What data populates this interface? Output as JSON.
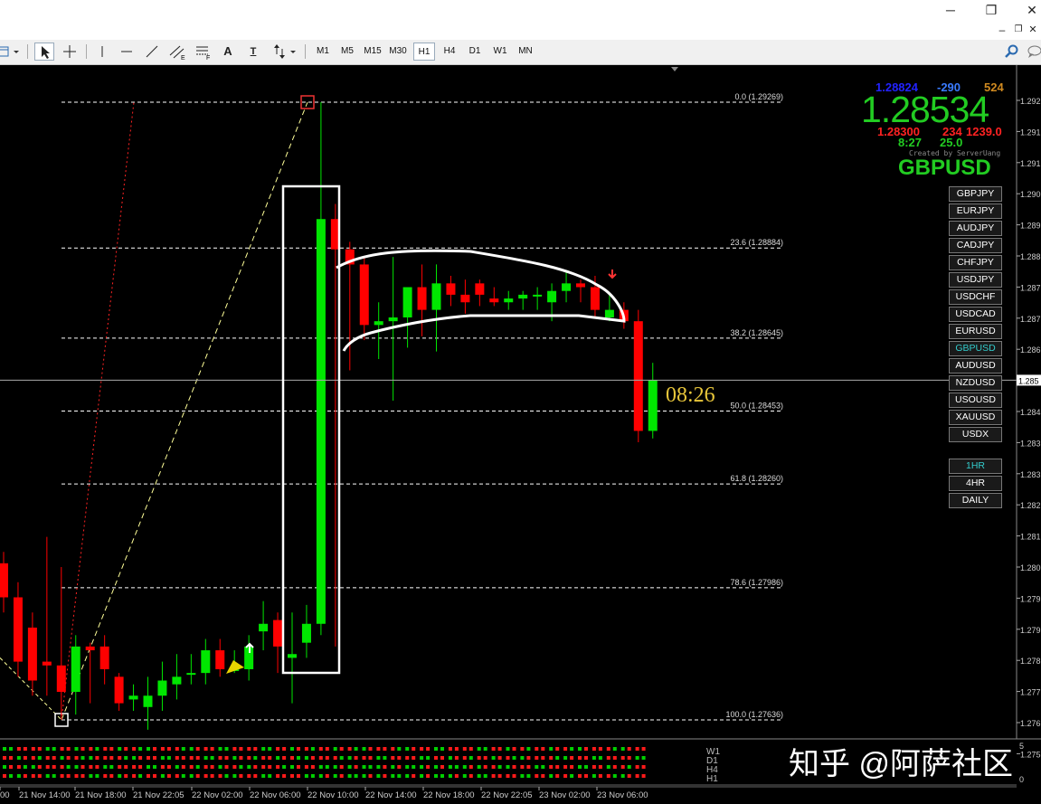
{
  "window": {
    "minimize": "─",
    "restore": "❐",
    "close": "✕",
    "inner_minimize": "–",
    "inner_restore": "❐",
    "inner_close": "✕"
  },
  "toolbar": {
    "timeframes": [
      "M1",
      "M5",
      "M15",
      "M30",
      "H1",
      "H4",
      "D1",
      "W1",
      "MN"
    ],
    "active_timeframe": "H1",
    "text_tool": "A",
    "text_label_tool": "T"
  },
  "price_axis": {
    "labels": [
      "1.292",
      "1.291",
      "1.291",
      "1.290",
      "1.289",
      "1.288",
      "1.287",
      "1.287",
      "1.286",
      "1.285",
      "1.284",
      "1.283",
      "1.283",
      "1.282",
      "1.281",
      "1.280",
      "1.279",
      "1.279",
      "1.278",
      "1.277",
      "1.276",
      "1.275"
    ],
    "current": "1.285"
  },
  "time_axis": {
    "labels": [
      "00",
      "21 Nov 14:00",
      "21 Nov 18:00",
      "21 Nov 22:05",
      "22 Nov 02:00",
      "22 Nov 06:00",
      "22 Nov 10:00",
      "22 Nov 14:00",
      "22 Nov 18:00",
      "22 Nov 22:05",
      "23 Nov 02:00",
      "23 Nov 06:00"
    ]
  },
  "fibonacci": [
    {
      "label": "0.0 (1.29269)"
    },
    {
      "label": "23.6 (1.28884)"
    },
    {
      "label": "38.2 (1.28645)"
    },
    {
      "label": "50.0 (1.28453)"
    },
    {
      "label": "61.8 (1.28260)"
    },
    {
      "label": "78.6 (1.27986)"
    },
    {
      "label": "100.0 (1.27636)"
    }
  ],
  "info_panel": {
    "bid": "1.28824",
    "spread": "-290",
    "range": "524",
    "price": "1.28534",
    "low": "1.28300",
    "pips": "234",
    "value": "1239.0",
    "time": "8:27",
    "num": "25.0",
    "credit": "Created by ServerUang",
    "symbol": "GBPUSD"
  },
  "countdown": "08:26",
  "symbol_buttons": [
    "GBPJPY",
    "EURJPY",
    "AUDJPY",
    "CADJPY",
    "CHFJPY",
    "USDJPY",
    "USDCHF",
    "USDCAD",
    "EURUSD",
    "GBPUSD",
    "AUDUSD",
    "NZDUSD",
    "USOUSD",
    "XAUUSD",
    "USDX"
  ],
  "active_symbol": "GBPUSD",
  "timeframe_buttons": [
    "1HR",
    "4HR",
    "DAILY"
  ],
  "active_tf_button": "1HR",
  "subwindow": {
    "rows": [
      "W1",
      "D1",
      "H4",
      "H1"
    ],
    "scale_top": "5",
    "scale_bottom": "0"
  },
  "watermark": "知乎 @阿萨社区",
  "colors": {
    "bull": "#00e600",
    "bear": "#ff0000",
    "fib": "#ffffff",
    "zigzag": "#ffff99",
    "zigzag_red": "#ff2222",
    "countdown": "#e8c63a",
    "price_big": "#22cc22"
  },
  "chart_data": {
    "type": "candlestick",
    "candles": [
      {
        "o": 1.2805,
        "h": 1.2808,
        "l": 1.2792,
        "c": 1.2796
      },
      {
        "o": 1.2796,
        "h": 1.28,
        "l": 1.2775,
        "c": 1.2779
      },
      {
        "o": 1.2788,
        "h": 1.2792,
        "l": 1.277,
        "c": 1.2774
      },
      {
        "o": 1.2779,
        "h": 1.2812,
        "l": 1.277,
        "c": 1.2778
      },
      {
        "o": 1.2778,
        "h": 1.2804,
        "l": 1.2764,
        "c": 1.2771
      },
      {
        "o": 1.2771,
        "h": 1.2786,
        "l": 1.2765,
        "c": 1.2783
      },
      {
        "o": 1.2783,
        "h": 1.2784,
        "l": 1.2768,
        "c": 1.2782
      },
      {
        "o": 1.2783,
        "h": 1.2786,
        "l": 1.2773,
        "c": 1.2777
      },
      {
        "o": 1.2775,
        "h": 1.2776,
        "l": 1.2766,
        "c": 1.2768
      },
      {
        "o": 1.2769,
        "h": 1.2773,
        "l": 1.2766,
        "c": 1.277
      },
      {
        "o": 1.2767,
        "h": 1.2775,
        "l": 1.2761,
        "c": 1.277
      },
      {
        "o": 1.277,
        "h": 1.2779,
        "l": 1.2766,
        "c": 1.2774
      },
      {
        "o": 1.2773,
        "h": 1.2781,
        "l": 1.2769,
        "c": 1.2775
      },
      {
        "o": 1.2776,
        "h": 1.2781,
        "l": 1.2773,
        "c": 1.2776
      },
      {
        "o": 1.2776,
        "h": 1.2785,
        "l": 1.2773,
        "c": 1.2782
      },
      {
        "o": 1.2782,
        "h": 1.2785,
        "l": 1.2775,
        "c": 1.2777
      },
      {
        "o": 1.2777,
        "h": 1.2782,
        "l": 1.2776,
        "c": 1.2777
      },
      {
        "o": 1.2777,
        "h": 1.2786,
        "l": 1.2774,
        "c": 1.2783
      },
      {
        "o": 1.2787,
        "h": 1.2795,
        "l": 1.2782,
        "c": 1.2789
      },
      {
        "o": 1.279,
        "h": 1.2792,
        "l": 1.2776,
        "c": 1.2783
      },
      {
        "o": 1.278,
        "h": 1.2792,
        "l": 1.2768,
        "c": 1.2781
      },
      {
        "o": 1.2784,
        "h": 1.2794,
        "l": 1.278,
        "c": 1.2789
      },
      {
        "o": 1.2789,
        "h": 1.29269,
        "l": 1.2786,
        "c": 1.2896
      },
      {
        "o": 1.2896,
        "h": 1.29,
        "l": 1.2783,
        "c": 1.2888
      },
      {
        "o": 1.2888,
        "h": 1.289,
        "l": 1.2856,
        "c": 1.2884
      },
      {
        "o": 1.2884,
        "h": 1.2886,
        "l": 1.2864,
        "c": 1.2868
      },
      {
        "o": 1.2868,
        "h": 1.2874,
        "l": 1.2859,
        "c": 1.2869
      },
      {
        "o": 1.2869,
        "h": 1.2886,
        "l": 1.2848,
        "c": 1.287
      },
      {
        "o": 1.287,
        "h": 1.2876,
        "l": 1.2862,
        "c": 1.2878
      },
      {
        "o": 1.2878,
        "h": 1.2884,
        "l": 1.2865,
        "c": 1.2872
      },
      {
        "o": 1.2872,
        "h": 1.2884,
        "l": 1.2861,
        "c": 1.2879
      },
      {
        "o": 1.2879,
        "h": 1.2881,
        "l": 1.2873,
        "c": 1.2876
      },
      {
        "o": 1.2876,
        "h": 1.288,
        "l": 1.2871,
        "c": 1.2874
      },
      {
        "o": 1.2879,
        "h": 1.288,
        "l": 1.2873,
        "c": 1.2876
      },
      {
        "o": 1.2875,
        "h": 1.2878,
        "l": 1.2873,
        "c": 1.2874
      },
      {
        "o": 1.2874,
        "h": 1.2877,
        "l": 1.2872,
        "c": 1.2875
      },
      {
        "o": 1.2875,
        "h": 1.2877,
        "l": 1.2872,
        "c": 1.2876
      },
      {
        "o": 1.2876,
        "h": 1.2878,
        "l": 1.2872,
        "c": 1.2876
      },
      {
        "o": 1.2874,
        "h": 1.2879,
        "l": 1.2869,
        "c": 1.2877
      },
      {
        "o": 1.2877,
        "h": 1.2882,
        "l": 1.2874,
        "c": 1.2879
      },
      {
        "o": 1.2879,
        "h": 1.288,
        "l": 1.2874,
        "c": 1.2878
      },
      {
        "o": 1.2878,
        "h": 1.2881,
        "l": 1.287,
        "c": 1.2872
      },
      {
        "o": 1.287,
        "h": 1.2876,
        "l": 1.2869,
        "c": 1.2872
      },
      {
        "o": 1.2872,
        "h": 1.2874,
        "l": 1.2867,
        "c": 1.2869
      },
      {
        "o": 1.2869,
        "h": 1.2872,
        "l": 1.2837,
        "c": 1.284
      },
      {
        "o": 1.284,
        "h": 1.2858,
        "l": 1.2838,
        "c": 1.28534
      }
    ]
  }
}
